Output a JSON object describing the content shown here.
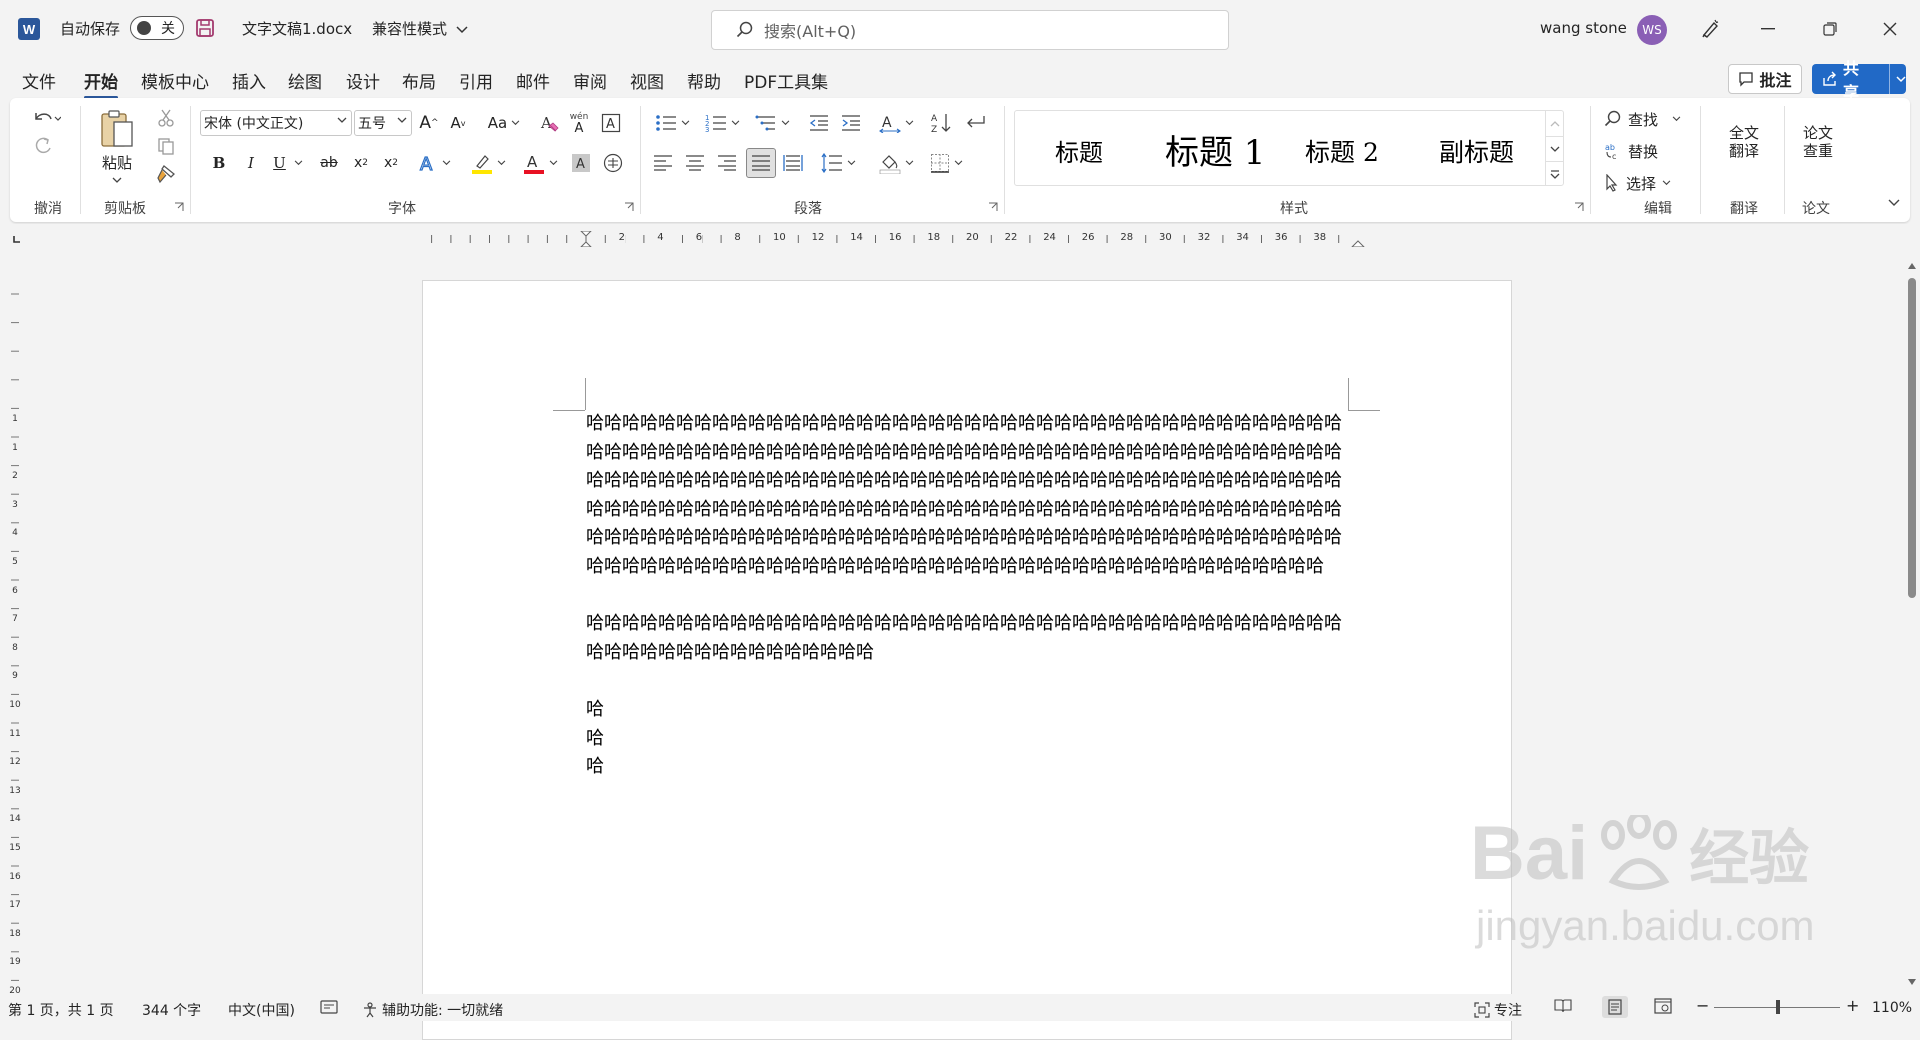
{
  "titlebar": {
    "app_logo": "W",
    "autosave_label": "自动保存",
    "autosave_state": "关",
    "doc_title": "文字文稿1.docx",
    "doc_mode": "兼容性模式",
    "search_placeholder": "搜索(Alt+Q)",
    "username": "wang stone",
    "avatar_initials": "WS"
  },
  "menu": {
    "tabs": [
      "文件",
      "开始",
      "模板中心",
      "插入",
      "绘图",
      "设计",
      "布局",
      "引用",
      "邮件",
      "审阅",
      "视图",
      "帮助",
      "PDF工具集"
    ],
    "active_tab": "开始",
    "comment_label": "批注",
    "share_label": "共享"
  },
  "ribbon": {
    "groups": {
      "undo": "撤消",
      "clipboard": "剪贴板",
      "font": "字体",
      "paragraph": "段落",
      "styles": "样式",
      "editing": "编辑",
      "translate": "翻译",
      "paper": "论文"
    },
    "paste_label": "粘贴",
    "font_name": "宋体 (中文正文)",
    "font_size": "五号",
    "change_case": "Aa",
    "phonetic_top": "wén",
    "phonetic_bottom": "A",
    "styles": [
      "标题",
      "标题 1",
      "标题 2",
      "副标题"
    ],
    "find_label": "查找",
    "replace_label": "替换",
    "select_label": "选择",
    "translate_btn_line1": "全文",
    "translate_btn_line2": "翻译",
    "paper_btn_line1": "论文",
    "paper_btn_line2": "查重"
  },
  "ruler": {
    "h_labels": [
      "2",
      "4",
      "6",
      "8",
      "10",
      "12",
      "14",
      "16",
      "18",
      "20",
      "22",
      "24",
      "26",
      "28",
      "30",
      "32",
      "34",
      "36",
      "38"
    ],
    "v_labels": [
      "1",
      "1",
      "2",
      "3",
      "4",
      "5",
      "6",
      "7",
      "8",
      "9",
      "10",
      "11",
      "12",
      "13",
      "14",
      "15",
      "16",
      "17",
      "18",
      "19",
      "20"
    ]
  },
  "document": {
    "para1": "哈哈哈哈哈哈哈哈哈哈哈哈哈哈哈哈哈哈哈哈哈哈哈哈哈哈哈哈哈哈哈哈哈哈哈哈哈哈哈哈哈哈哈哈哈哈哈哈哈哈哈哈哈哈哈哈哈哈哈哈哈哈哈哈哈哈哈哈哈哈哈哈哈哈哈哈哈哈哈哈哈哈哈哈哈哈哈哈哈哈哈哈哈哈哈哈哈哈哈哈哈哈哈哈哈哈哈哈哈哈哈哈哈哈哈哈哈哈哈哈哈哈哈哈哈哈哈哈哈哈哈哈哈哈哈哈哈哈哈哈哈哈哈哈哈哈哈哈哈哈哈哈哈哈哈哈哈哈哈哈哈哈哈哈哈哈哈哈哈哈哈哈哈哈哈哈哈哈哈哈哈哈哈哈哈哈哈哈哈哈哈哈哈哈哈哈哈哈哈哈哈哈哈哈哈哈哈哈哈哈哈哈哈哈哈哈哈哈哈哈哈哈哈哈哈哈哈哈哈哈哈哈哈哈哈哈哈哈哈哈哈哈哈哈哈哈哈哈哈哈哈",
    "para2": "哈哈哈哈哈哈哈哈哈哈哈哈哈哈哈哈哈哈哈哈哈哈哈哈哈哈哈哈哈哈哈哈哈哈哈哈哈哈哈哈哈哈哈哈哈哈哈哈哈哈哈哈哈哈哈哈哈哈",
    "line_a": "哈",
    "line_b": "哈",
    "line_c": "哈"
  },
  "status": {
    "page": "第 1 页，共 1 页",
    "words": "344 个字",
    "language": "中文(中国)",
    "accessibility": "辅助功能: 一切就绪",
    "focus": "专注",
    "zoom": "110%"
  },
  "watermark": {
    "logo_text": "Bai",
    "logo_cn": "经验",
    "url": "jingyan.baidu.com"
  }
}
